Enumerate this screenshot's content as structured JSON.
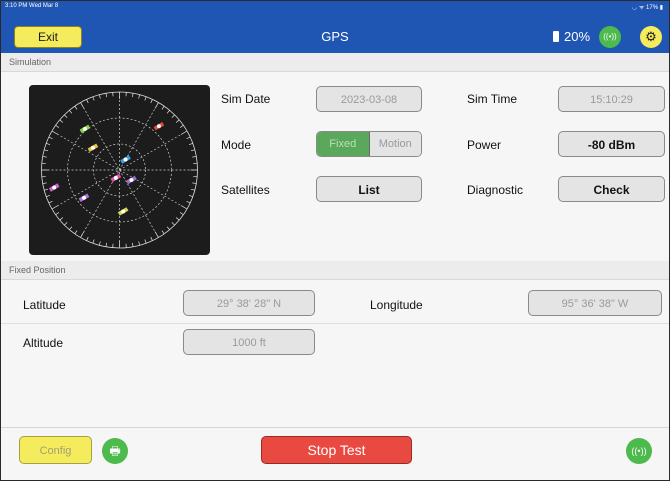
{
  "statusbar": {
    "time": "3:10 PM  Wed Mar 8",
    "right": "◡ ᯤ 17% ▮"
  },
  "header": {
    "exit_label": "Exit",
    "title": "GPS",
    "battery": "20%",
    "wireless_icon": "((•))",
    "settings_icon": "⚙"
  },
  "sections": {
    "simulation": "Simulation",
    "fixed_position": "Fixed Position"
  },
  "simulation": {
    "sim_date_label": "Sim Date",
    "sim_date_value": "2023-03-08",
    "sim_time_label": "Sim Time",
    "sim_time_value": "15:10:29",
    "mode_label": "Mode",
    "mode_options": [
      "Fixed",
      "Motion"
    ],
    "mode_selected": "Fixed",
    "power_label": "Power",
    "power_value": "-80 dBm",
    "satellites_label": "Satellites",
    "satellites_button": "List",
    "diagnostic_label": "Diagnostic",
    "diagnostic_button": "Check"
  },
  "position": {
    "latitude_label": "Latitude",
    "latitude_value": "29° 38' 28\" N",
    "longitude_label": "Longitude",
    "longitude_value": "95° 36' 38\" W",
    "altitude_label": "Altitude",
    "altitude_value": "1000 ft"
  },
  "footer": {
    "config_label": "Config",
    "print_icon": "🖶",
    "stop_label": "Stop Test",
    "wireless_icon": "((•))"
  },
  "colors": {
    "header_bg": "#1f55b3",
    "yellow_button": "#f4ec5c",
    "green_button": "#4cba4c",
    "stop_button": "#e84a42",
    "skyplot_bg": "#1c1c1c"
  },
  "skyplot": {
    "satellites": [
      {
        "color": "#e84a42",
        "azimuth": 42,
        "elevation": 22
      },
      {
        "color": "#e0c040",
        "azimuth": 310,
        "elevation": 50
      },
      {
        "color": "#8ad24a",
        "azimuth": 320,
        "elevation": 28
      },
      {
        "color": "#3aa0e0",
        "azimuth": 30,
        "elevation": 76
      },
      {
        "color": "#9a6ad8",
        "azimuth": 130,
        "elevation": 72
      },
      {
        "color": "#e050b0",
        "azimuth": 205,
        "elevation": 80
      },
      {
        "color": "#d8d84a",
        "azimuth": 175,
        "elevation": 42
      },
      {
        "color": "#b070e0",
        "azimuth": 232,
        "elevation": 38
      },
      {
        "color": "#d060d0",
        "azimuth": 255,
        "elevation": 12
      }
    ]
  }
}
